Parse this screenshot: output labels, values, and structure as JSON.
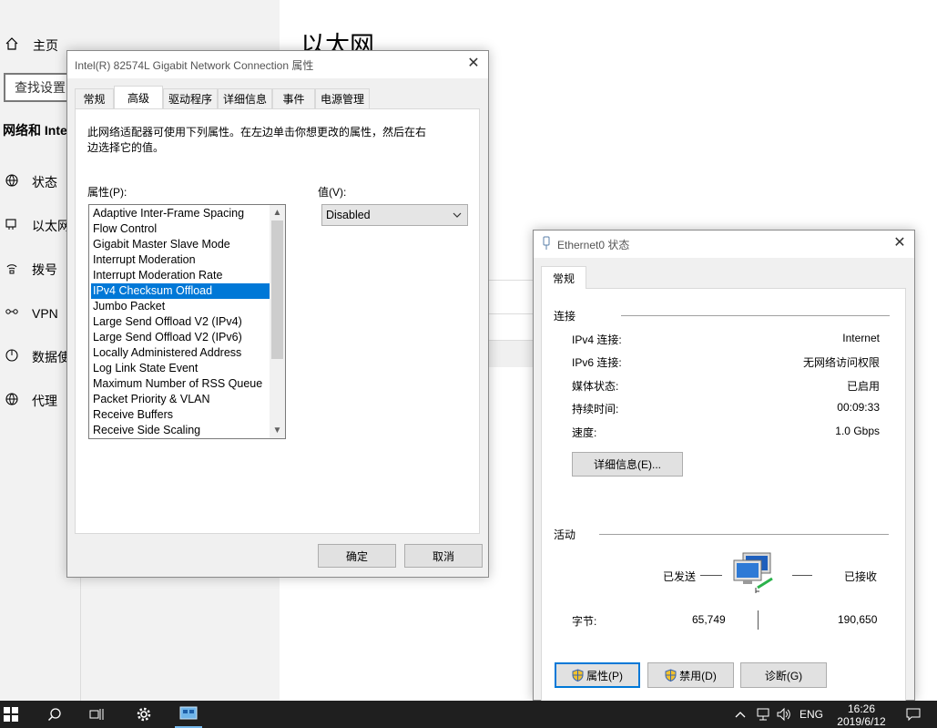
{
  "settings": {
    "home_label": "主页",
    "search_placeholder": "查找设置",
    "section_title": "网络和 Inte",
    "page_title": "以太网",
    "nav_items": [
      {
        "label": "状态",
        "icon": "globe-status-icon"
      },
      {
        "label": "以太网",
        "icon": "ethernet-icon"
      },
      {
        "label": "拨号",
        "icon": "dialup-icon"
      },
      {
        "label": "VPN",
        "icon": "vpn-icon"
      },
      {
        "label": "数据使",
        "icon": "data-usage-icon"
      },
      {
        "label": "代理",
        "icon": "proxy-globe-icon"
      }
    ]
  },
  "props_dialog": {
    "title": "Intel(R) 82574L Gigabit Network Connection 属性",
    "tabs": [
      "常规",
      "高级",
      "驱动程序",
      "详细信息",
      "事件",
      "电源管理"
    ],
    "active_tab": "高级",
    "description": "此网络适配器可使用下列属性。在左边单击你想更改的属性，然后在右边选择它的值。",
    "property_label": "属性(P):",
    "value_label": "值(V):",
    "properties": [
      "Adaptive Inter-Frame Spacing",
      "Flow Control",
      "Gigabit Master Slave Mode",
      "Interrupt Moderation",
      "Interrupt Moderation Rate",
      "IPv4 Checksum Offload",
      "Jumbo Packet",
      "Large Send Offload V2 (IPv4)",
      "Large Send Offload V2 (IPv6)",
      "Locally Administered Address",
      "Log Link State Event",
      "Maximum Number of RSS Queue",
      "Packet Priority & VLAN",
      "Receive Buffers",
      "Receive Side Scaling"
    ],
    "selected_property": "IPv4 Checksum Offload",
    "selected_value": "Disabled",
    "ok_label": "确定",
    "cancel_label": "取消"
  },
  "status_dialog": {
    "title": "Ethernet0 状态",
    "tab": "常规",
    "connection_header": "连接",
    "rows": [
      {
        "key": "IPv4 连接:",
        "value": "Internet"
      },
      {
        "key": "IPv6 连接:",
        "value": "无网络访问权限"
      },
      {
        "key": "媒体状态:",
        "value": "已启用"
      },
      {
        "key": "持续时间:",
        "value": "00:09:33"
      },
      {
        "key": "速度:",
        "value": "1.0 Gbps"
      }
    ],
    "details_button": "详细信息(E)...",
    "activity_header": "活动",
    "sent_label": "已发送",
    "received_label": "已接收",
    "bytes_label": "字节:",
    "bytes_sent": "65,749",
    "bytes_received": "190,650",
    "properties_button": "属性(P)",
    "disable_button": "禁用(D)",
    "diagnose_button": "诊断(G)"
  },
  "taskbar": {
    "time": "16:26",
    "date": "2019/6/12",
    "language": "ENG"
  },
  "colors": {
    "selection": "#0078d7",
    "taskbar": "#1f1f1f",
    "dialog_bg": "#f0f0f0"
  }
}
